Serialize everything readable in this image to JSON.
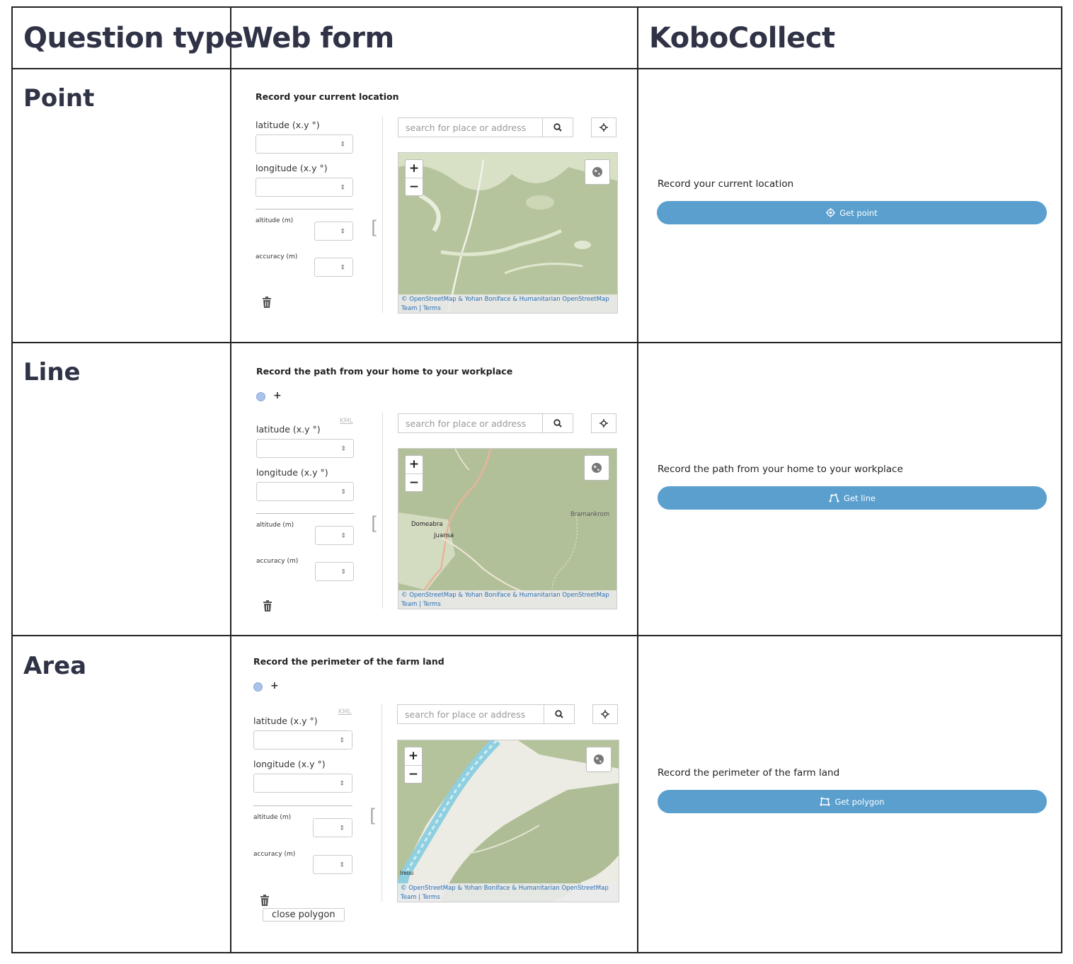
{
  "headers": {
    "question_type": "Question type",
    "web_form": "Web form",
    "kobocollect": "KoboCollect"
  },
  "rows": [
    {
      "type": "Point",
      "web": {
        "title": "Record your current location",
        "latitude": "latitude (x.y °)",
        "longitude": "longitude (x.y °)",
        "altitude": "altitude (m)",
        "accuracy": "accuracy (m)",
        "search_placeholder": "search for place or address",
        "attribution_1": "© OpenStreetMap & Yohan Boniface & Humanitarian OpenStreetMap",
        "attribution_2": "Team | Terms"
      },
      "kobo": {
        "question": "Record your current location",
        "button": "Get point",
        "icon": "crosshair-icon"
      }
    },
    {
      "type": "Line",
      "web": {
        "title": "Record the path from your home to your workplace",
        "kml": "KML",
        "latitude": "latitude (x.y °)",
        "longitude": "longitude (x.y °)",
        "altitude": "altitude (m)",
        "accuracy": "accuracy (m)",
        "search_placeholder": "search for place or address",
        "attribution_1": "© OpenStreetMap & Yohan Boniface & Humanitarian OpenStreetMap",
        "attribution_2": "Team | Terms",
        "places": [
          "Domeabra",
          "Juansa",
          "Bramankrom"
        ]
      },
      "kobo": {
        "question": "Record the path from your home to your workplace",
        "button": "Get line",
        "icon": "line-path-icon"
      }
    },
    {
      "type": "Area",
      "web": {
        "title": "Record the perimeter of the farm land",
        "kml": "KML",
        "latitude": "latitude (x.y °)",
        "longitude": "longitude (x.y °)",
        "altitude": "altitude (m)",
        "accuracy": "accuracy (m)",
        "search_placeholder": "search for place or address",
        "attribution_1": "© OpenStreetMap & Yohan Boniface & Humanitarian OpenStreetMap",
        "attribution_2": "Team | Terms",
        "places": [
          "Irebu"
        ],
        "close_polygon": "close polygon"
      },
      "kobo": {
        "question": "Record the perimeter of the farm land",
        "button": "Get polygon",
        "icon": "polygon-icon"
      }
    }
  ],
  "colors": {
    "kobo_button": "#5a9fce",
    "map_green": "#b5c39c",
    "header_text": "#2f3345"
  }
}
